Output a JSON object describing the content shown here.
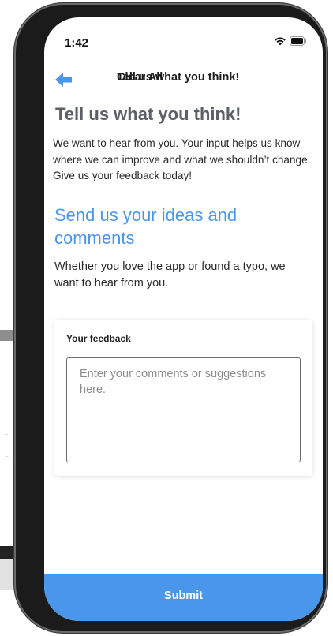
{
  "status_bar": {
    "time": "1:42",
    "signal": "....."
  },
  "nav": {
    "title": "Tell us what you think!",
    "clear_label": "Clear All",
    "back_icon": "arrow-left-icon"
  },
  "main": {
    "heading": "Tell us what you think!",
    "intro": "We want to hear from you. Your input helps us know where we can improve and what we shouldn’t change. Give us your feedback today!",
    "ideas_heading": "Send us your ideas and comments",
    "ideas_sub": "Whether you love the app or found a typo, we want to hear from you."
  },
  "feedback_card": {
    "label": "Your feedback",
    "placeholder": "Enter your comments or suggestions here.",
    "value": ""
  },
  "submit_label": "Submit",
  "colors": {
    "accent": "#4a96ea",
    "heading_gray": "#5b5f66"
  }
}
